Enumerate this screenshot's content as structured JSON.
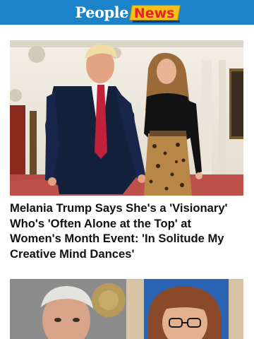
{
  "header": {
    "logo_people": "People",
    "logo_news": "News",
    "brand_color": "#1a83c9",
    "accent_yellow": "#f3c11a",
    "accent_red": "#e8232a"
  },
  "articles": [
    {
      "title": "Melania Trump Says She's a 'Visionary' Who's 'Often Alone at the Top' at Women's Month Event: 'In Solitude My Creative Mind Dances'"
    },
    {
      "title": ""
    }
  ]
}
